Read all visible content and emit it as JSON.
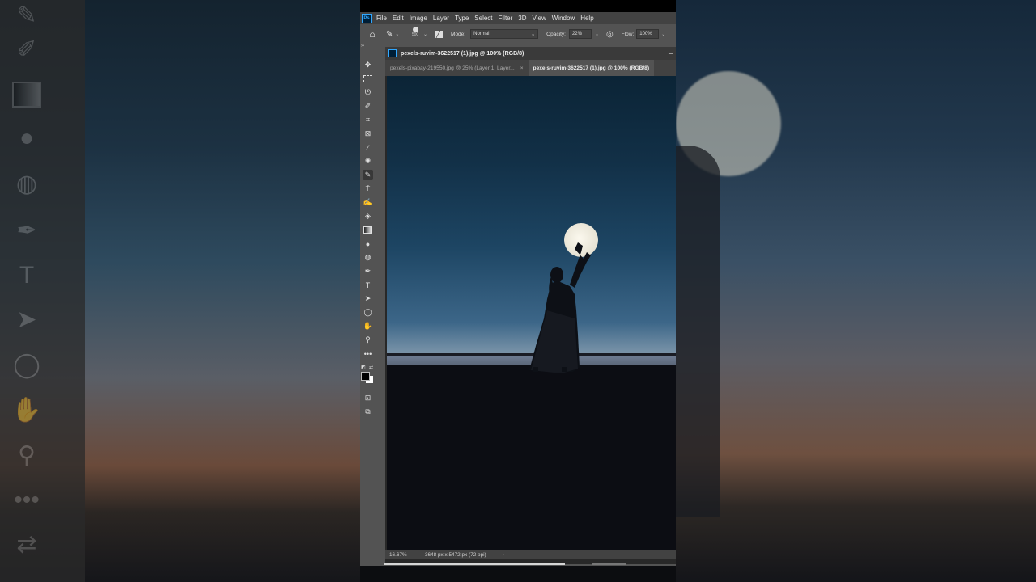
{
  "menu": {
    "app_badge": "Ps",
    "items": [
      "File",
      "Edit",
      "Image",
      "Layer",
      "Type",
      "Select",
      "Filter",
      "3D",
      "View",
      "Window",
      "Help"
    ]
  },
  "options": {
    "brush_size": "500",
    "mode_label": "Mode:",
    "mode_value": "Normal",
    "opacity_label": "Opacity:",
    "opacity_value": "22%",
    "flow_label": "Flow:",
    "flow_value": "100%"
  },
  "document": {
    "title": "pexels-ruvim-3622517 (1).jpg @ 100% (RGB/8)",
    "tabs": [
      {
        "label": "pexels-pixabay-219550.jpg @ 25% (Layer 1, Layer...",
        "active": false
      },
      {
        "label": "pexels-ruvim-3622517 (1).jpg @ 100% (RGB/8)",
        "active": true
      }
    ]
  },
  "status": {
    "zoom": "16.67%",
    "dimensions": "3648 px x 5472 px (72 ppi)",
    "arrow": "›"
  },
  "colors": {
    "foreground": "#000000",
    "background": "#ffffff"
  },
  "tools": [
    "move-tool-icon",
    "marquee-tool-icon",
    "lasso-tool-icon",
    "quick-select-tool-icon",
    "crop-tool-icon",
    "frame-tool-icon",
    "eyedropper-tool-icon",
    "healing-brush-tool-icon",
    "brush-tool-icon",
    "clone-stamp-tool-icon",
    "history-brush-tool-icon",
    "eraser-tool-icon",
    "gradient-tool-icon",
    "blur-tool-icon",
    "dodge-tool-icon",
    "pen-tool-icon",
    "type-tool-icon",
    "path-select-tool-icon",
    "ellipse-tool-icon",
    "hand-tool-icon",
    "zoom-tool-icon",
    "more-tools-icon"
  ]
}
